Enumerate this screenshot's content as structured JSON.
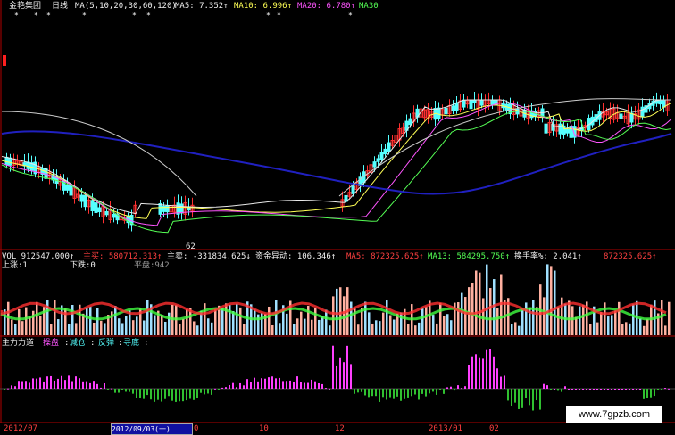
{
  "header": {
    "stock_name": "金艳集团",
    "period": "日线",
    "ma_params": "MA(5,10,20,30,60,120)",
    "ma5": "MA5: 7.352↑",
    "ma10": "MA10: 6.996↑",
    "ma20": "MA20: 6.780↑",
    "ma30": "MA30"
  },
  "price_panel": {
    "low_label": "62"
  },
  "volume_panel": {
    "vol": "VOL 912547.000↑",
    "main_buy": "主买: 580712.313↑",
    "main_sell": "主卖: -331834.625↓",
    "fund_flow": "资金异动: 106.346↑",
    "ma5": "MA5: 872325.625↑",
    "ma13": "MA13: 584295.750↑",
    "turnover": "换手率%: 2.041↑",
    "ma_last": "872325.625↑",
    "up_count": "上涨:1",
    "down_count": "下跌:0",
    "flat_count": "平盘:942"
  },
  "indicator_panel": {
    "title": "主力力道",
    "wash": "操盘",
    "reduce": "减仓",
    "rebound": "反弹",
    "bottom": "寻底"
  },
  "date_axis": {
    "labels": [
      "2012/07",
      "0",
      "10",
      "12",
      "2013/01",
      "02"
    ],
    "cursor_date": "2012/09/03(一)"
  },
  "watermark": "www.7gpzb.com",
  "colors": {
    "candle_up": "#ff3030",
    "candle_down": "#55ffff",
    "ma_white": "#e8e8e8",
    "ma_yellow": "#ffff55",
    "ma_magenta": "#ff55ff",
    "ma_green": "#55ff55",
    "ma_blue": "#2020c0",
    "grid": "#b00000"
  }
}
